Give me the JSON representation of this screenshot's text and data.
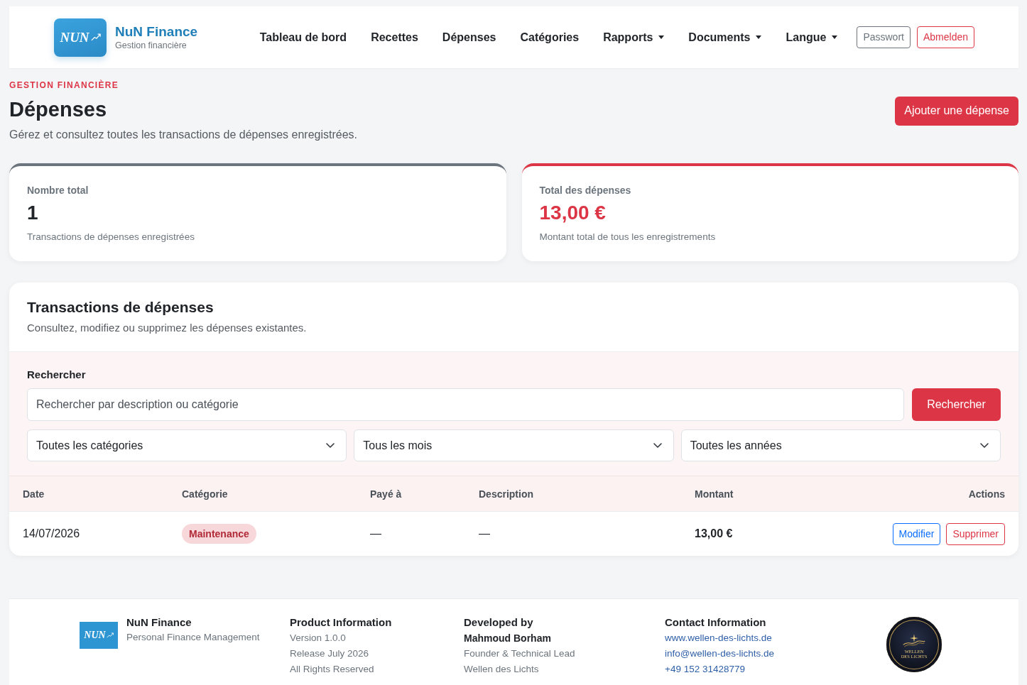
{
  "navbar": {
    "brand": {
      "logo_text": "NUN",
      "name": "NuN Finance",
      "tagline": "Gestion financière"
    },
    "links": [
      {
        "label": "Tableau de bord",
        "dropdown": false
      },
      {
        "label": "Recettes",
        "dropdown": false
      },
      {
        "label": "Dépenses",
        "dropdown": false
      },
      {
        "label": "Catégories",
        "dropdown": false
      },
      {
        "label": "Rapports",
        "dropdown": true
      },
      {
        "label": "Documents",
        "dropdown": true
      },
      {
        "label": "Langue",
        "dropdown": true
      }
    ],
    "buttons": [
      {
        "label": "Passwort",
        "kind": "secondary"
      },
      {
        "label": "Abmelden",
        "kind": "danger"
      }
    ]
  },
  "header": {
    "eyebrow": "GESTION FINANCIÈRE",
    "title": "Dépenses",
    "subtitle": "Gérez et consultez toutes les transactions de dépenses enregistrées.",
    "action": "Ajouter une dépense"
  },
  "stats": [
    {
      "kind": "count",
      "label": "Nombre total",
      "value": "1",
      "caption": "Transactions de dépenses enregistrées"
    },
    {
      "kind": "amount",
      "label": "Total des dépenses",
      "value": "13,00 €",
      "caption": "Montant total de tous les enregistrements"
    }
  ],
  "transactions": {
    "title": "Transactions de dépenses",
    "subtitle": "Consultez, modifiez ou supprimez les dépenses existantes.",
    "search": {
      "label": "Rechercher",
      "placeholder": "Rechercher par description ou catégorie",
      "button": "Rechercher"
    },
    "filters": [
      {
        "value": "Toutes les catégories"
      },
      {
        "value": "Tous les mois"
      },
      {
        "value": "Toutes les années"
      }
    ],
    "table": {
      "columns": [
        "Date",
        "Catégorie",
        "Payé à",
        "Description",
        "Montant",
        "Actions"
      ],
      "rows": [
        {
          "date": "14/07/2026",
          "category": "Maintenance",
          "paid_to": "—",
          "description": "—",
          "amount": "13,00 €",
          "actions": [
            {
              "label": "Modifier",
              "kind": "edit"
            },
            {
              "label": "Supprimer",
              "kind": "delete"
            }
          ]
        }
      ]
    }
  },
  "footer": {
    "brand": {
      "logo_text": "NUN",
      "name": "NuN Finance",
      "tagline": "Personal Finance Management"
    },
    "columns": [
      {
        "title": "Product Information",
        "lines": [
          {
            "text": "Version 1.0.0",
            "kind": "text"
          },
          {
            "text": "Release July 2026",
            "kind": "text"
          },
          {
            "text": "All Rights Reserved",
            "kind": "text"
          }
        ]
      },
      {
        "title": "Developed by",
        "lines": [
          {
            "text": "Mahmoud Borham",
            "kind": "name"
          },
          {
            "text": "Founder & Technical Lead",
            "kind": "text"
          },
          {
            "text": "Wellen des Lichts",
            "kind": "text"
          }
        ]
      },
      {
        "title": "Contact Information",
        "lines": [
          {
            "text": "www.wellen-des-lichts.de",
            "kind": "link"
          },
          {
            "text": "info@wellen-des-lichts.de",
            "kind": "link"
          },
          {
            "text": "+49 152 31428779",
            "kind": "link"
          }
        ]
      }
    ],
    "badge": {
      "lines": [
        "WELLEN",
        "DES LICHTS"
      ]
    }
  }
}
